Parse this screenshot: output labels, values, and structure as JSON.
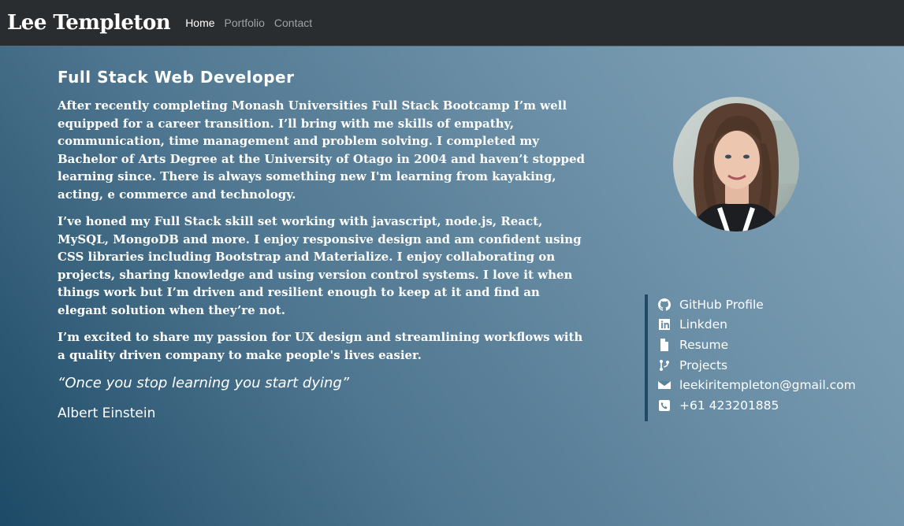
{
  "nav": {
    "brand": "Lee Templeton",
    "links": [
      {
        "label": "Home",
        "active": true
      },
      {
        "label": "Portfolio",
        "active": false
      },
      {
        "label": "Contact",
        "active": false
      }
    ]
  },
  "main": {
    "headline": "Full Stack Web Developer",
    "paragraphs": [
      "After recently completing Monash Universities Full Stack Bootcamp I’m well equipped for a career transition. I’ll bring with me skills of empathy, communication, time management and problem solving. I completed my Bachelor of Arts Degree at the University of Otago in 2004 and haven’t stopped learning since. There is always something new I'm learning from kayaking, acting, e commerce and technology.",
      "I’ve honed my Full Stack skill set working with javascript, node.js, React, MySQL, MongoDB and more. I enjoy responsive design and am confident using CSS libraries including Bootstrap and Materialize. I enjoy collaborating on projects, sharing knowledge and using version control systems. I love it when things work but I’m driven and resilient enough to keep at it and find an elegant solution when they’re not.",
      "I’m excited to share my passion for UX design and streamlining workflows with a quality driven company to make people's lives easier."
    ],
    "quote": "“Once you stop learning you start dying”",
    "author": "Albert Einstein"
  },
  "contacts": [
    {
      "icon": "github-icon",
      "label": "GitHub Profile"
    },
    {
      "icon": "linkedin-icon",
      "label": "Linkden"
    },
    {
      "icon": "file-icon",
      "label": "Resume"
    },
    {
      "icon": "code-branch-icon",
      "label": "Projects"
    },
    {
      "icon": "envelope-icon",
      "label": "leekiritempleton@gmail.com"
    },
    {
      "icon": "phone-icon",
      "label": "+61 423201885"
    }
  ],
  "colors": {
    "navbar": "#2a2d2f",
    "accent_bar": "#1d4a66",
    "text": "#ffffff"
  }
}
